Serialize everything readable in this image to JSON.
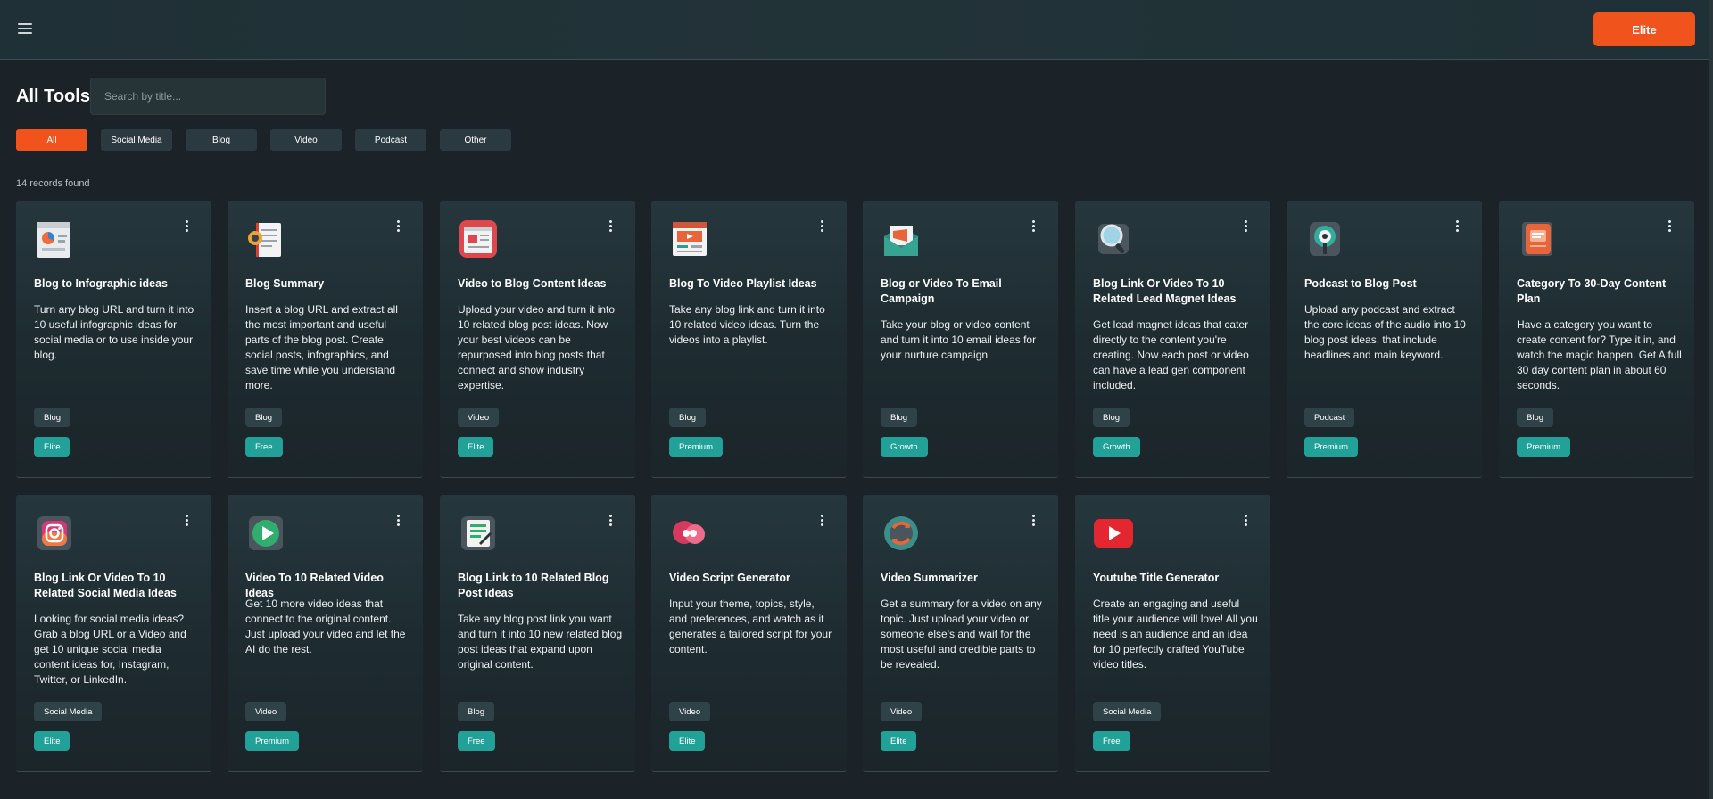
{
  "header": {
    "elite_label": "Elite"
  },
  "page": {
    "title": "All Tools",
    "search_placeholder": "Search by title...",
    "records": "14 records found"
  },
  "filters": [
    "All",
    "Social Media",
    "Blog",
    "Video",
    "Podcast",
    "Other"
  ],
  "cards": [
    {
      "title": "Blog to Infographic ideas",
      "desc": "Turn any blog URL and turn it into  10 useful infographic ideas for social media or to use inside your blog.",
      "category": "Blog",
      "tier": "Elite",
      "icon": "infographic-icon"
    },
    {
      "title": "Blog Summary",
      "desc": "Insert a blog URL and extract all the most important and useful parts of the blog post.  Create social posts, infographics, and save time while you understand more.",
      "category": "Blog",
      "tier": "Free",
      "icon": "summary-document-icon"
    },
    {
      "title": "Video to Blog Content Ideas",
      "desc": "Upload your video and turn it into 10 related blog post ideas. Now your best videos can be repurposed into blog posts that connect and show industry expertise.",
      "category": "Video",
      "tier": "Elite",
      "icon": "video-blog-icon"
    },
    {
      "title": "Blog To Video Playlist Ideas",
      "desc": "Take any blog link and turn it into 10 related video ideas.  Turn the videos into a playlist.",
      "category": "Blog",
      "tier": "Premium",
      "icon": "video-playlist-icon"
    },
    {
      "title": "Blog or Video To Email Campaign",
      "desc": "Take your blog or video content and turn it into 10 email ideas for your nurture campaign",
      "category": "Blog",
      "tier": "Growth",
      "icon": "email-campaign-icon"
    },
    {
      "title": "Blog Link Or Video To 10 Related Lead Magnet Ideas",
      "desc": "Get lead magnet ideas that cater directly to the content you're creating. Now each post or video can have a lead gen component included.",
      "category": "Blog",
      "tier": "Growth",
      "icon": "magnifier-icon"
    },
    {
      "title": "Podcast to Blog Post",
      "desc": "Upload any podcast and extract the core ideas of the audio  into 10 blog post ideas, that include headlines and main keyword.",
      "category": "Podcast",
      "tier": "Premium",
      "icon": "podcast-icon"
    },
    {
      "title": "Category To 30-Day Content Plan",
      "desc": "Have a category you want to create content for? Type it in, and watch the magic happen. Get A full 30 day content plan in about 60 seconds.",
      "category": "Blog",
      "tier": "Premium",
      "icon": "content-plan-icon"
    },
    {
      "title": "Blog Link Or Video To 10 Related Social Media Ideas",
      "desc": "Looking for social media ideas?  Grab a blog URL or a Video and get 10 unique social media content ideas for, Instagram, Twitter, or LinkedIn.",
      "category": "Social Media",
      "tier": "Elite",
      "icon": "instagram-icon"
    },
    {
      "title": "Video To 10 Related Video Ideas",
      "desc": "Get 10 more video ideas that connect to the original content. Just upload your video and let the AI do the rest.",
      "category": "Video",
      "tier": "Premium",
      "icon": "play-icon"
    },
    {
      "title": "Blog Link to 10 Related Blog Post Ideas",
      "desc": "Take any blog post link you want and turn it into 10 new related blog post ideas that expand upon original content.",
      "category": "Blog",
      "tier": "Free",
      "icon": "blog-post-icon"
    },
    {
      "title": "Video Script Generator",
      "desc": "Input your theme, topics, style, and preferences, and watch as it generates a tailored script for your content.",
      "category": "Video",
      "tier": "Elite",
      "icon": "script-icon"
    },
    {
      "title": "Video Summarizer",
      "desc": "Get a summary for a video on any topic. Just upload your video or someone else's and wait for the most useful and credible parts to be revealed.",
      "category": "Video",
      "tier": "Elite",
      "icon": "summarizer-gear-icon"
    },
    {
      "title": "Youtube Title Generator",
      "desc": "Create an engaging and useful  title your audience will love! All you need is an audience and an idea for 10 perfectly crafted YouTube video titles.",
      "category": "Social Media",
      "tier": "Free",
      "icon": "youtube-icon"
    }
  ]
}
